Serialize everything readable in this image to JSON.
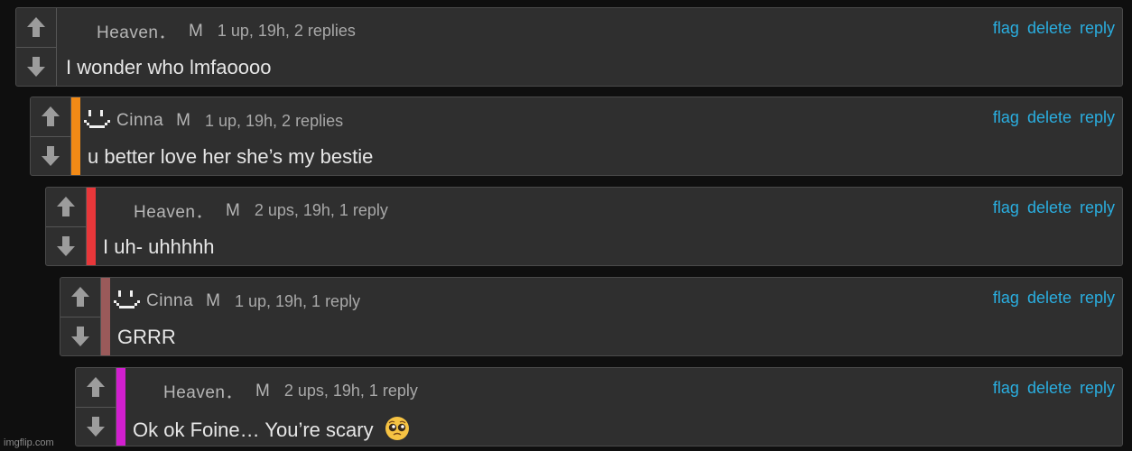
{
  "comments": [
    {
      "username": "Heaven．",
      "rank": "M",
      "stats": "1 up, 19h, 2 replies",
      "text": "I wonder who lmfaoooo",
      "has_avatar": false,
      "bar_color": null
    },
    {
      "username": "Cinna",
      "rank": "M",
      "stats": "1 up, 19h, 2 replies",
      "text": "u better love her she’s my bestie",
      "has_avatar": true,
      "bar_color": "#f28a16"
    },
    {
      "username": "Heaven．",
      "rank": "M",
      "stats": "2 ups, 19h, 1 reply",
      "text": "I uh- uhhhhh",
      "has_avatar": false,
      "bar_color": "#e8373a"
    },
    {
      "username": "Cinna",
      "rank": "M",
      "stats": "1 up, 19h, 1 reply",
      "text": "GRRR",
      "has_avatar": true,
      "bar_color": "#9a5a5a"
    },
    {
      "username": "Heaven．",
      "rank": "M",
      "stats": "2 ups, 19h, 1 reply",
      "text": "Ok ok Foine… You’re scary",
      "has_avatar": false,
      "bar_color": "#d21fcf",
      "emoji": "pleading-face-emoji"
    }
  ],
  "actions": {
    "flag": "flag",
    "delete": "delete",
    "reply": "reply"
  },
  "icons": {
    "upvote": "arrow-up-icon",
    "downvote": "arrow-down-icon",
    "avatar": "pixel-smiley-avatar"
  },
  "colors": {
    "link": "#2aaee0",
    "background": "#0f0f0f",
    "panel": "#2f2f2f"
  },
  "watermark": "imgflip.com"
}
